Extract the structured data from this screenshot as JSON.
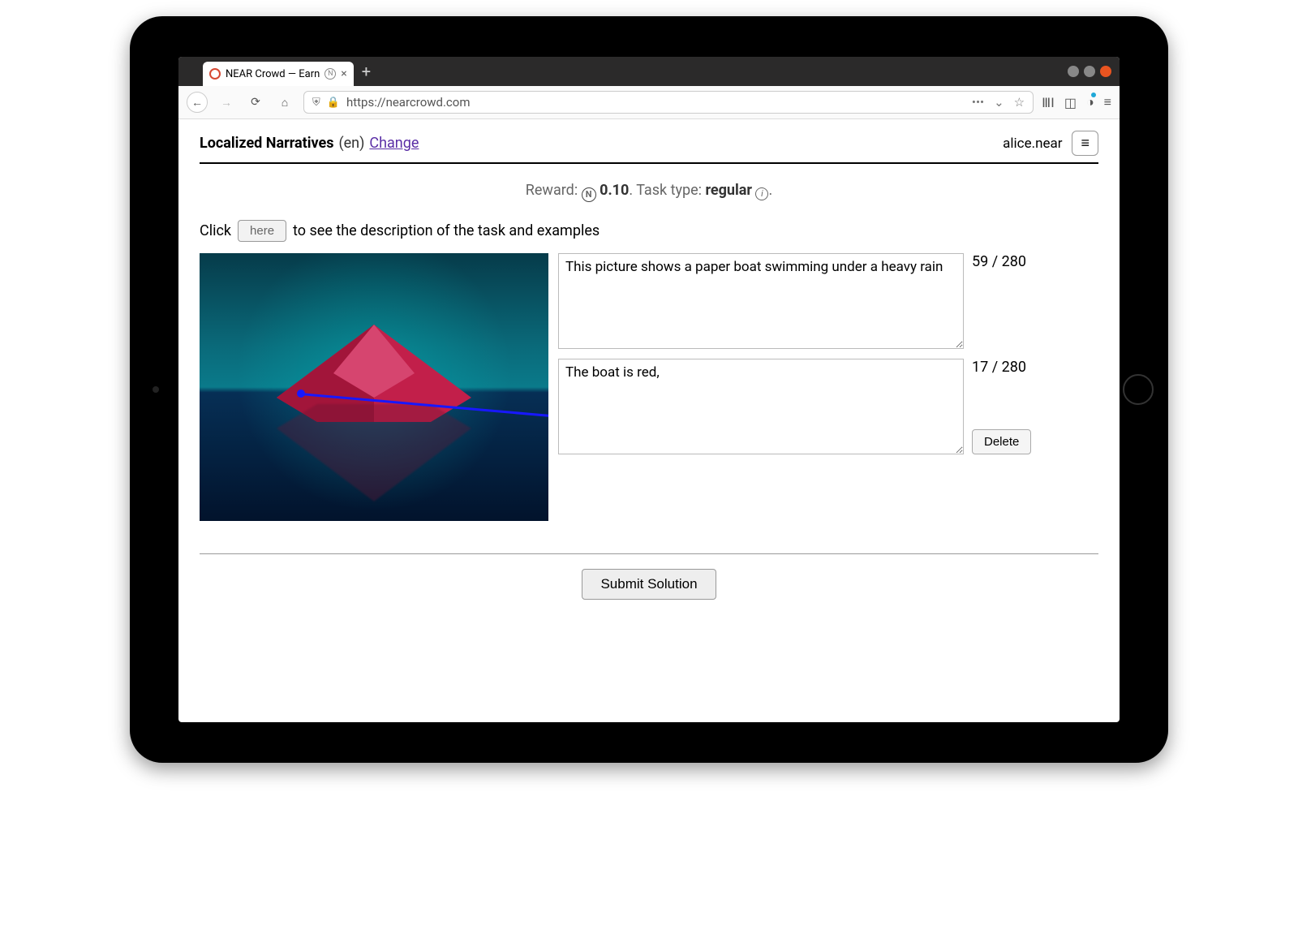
{
  "browser": {
    "tab_title": "NEAR Crowd — Earn",
    "url": "https://nearcrowd.com"
  },
  "header": {
    "title": "Localized Narratives",
    "lang": "(en)",
    "change_label": "Change",
    "username": "alice.near"
  },
  "reward": {
    "reward_label": "Reward:",
    "currency_symbol": "N",
    "amount": "0.10",
    "task_type_label": "Task type:",
    "task_type": "regular"
  },
  "help": {
    "prefix": "Click",
    "here_label": "here",
    "suffix": "to see the description of the task and examples"
  },
  "entries": [
    {
      "text": "This picture shows a paper boat swimming under a heavy rain",
      "count": "59 / 280"
    },
    {
      "text": "The boat is red, ",
      "count": "17 / 280"
    }
  ],
  "buttons": {
    "delete": "Delete",
    "submit": "Submit Solution"
  },
  "image": {
    "description": "Red origami paper boat on water under heavy rain with reflection",
    "trace": {
      "start": [
        120,
        168
      ],
      "end": [
        440,
        200
      ],
      "color": "#1818ff"
    }
  }
}
